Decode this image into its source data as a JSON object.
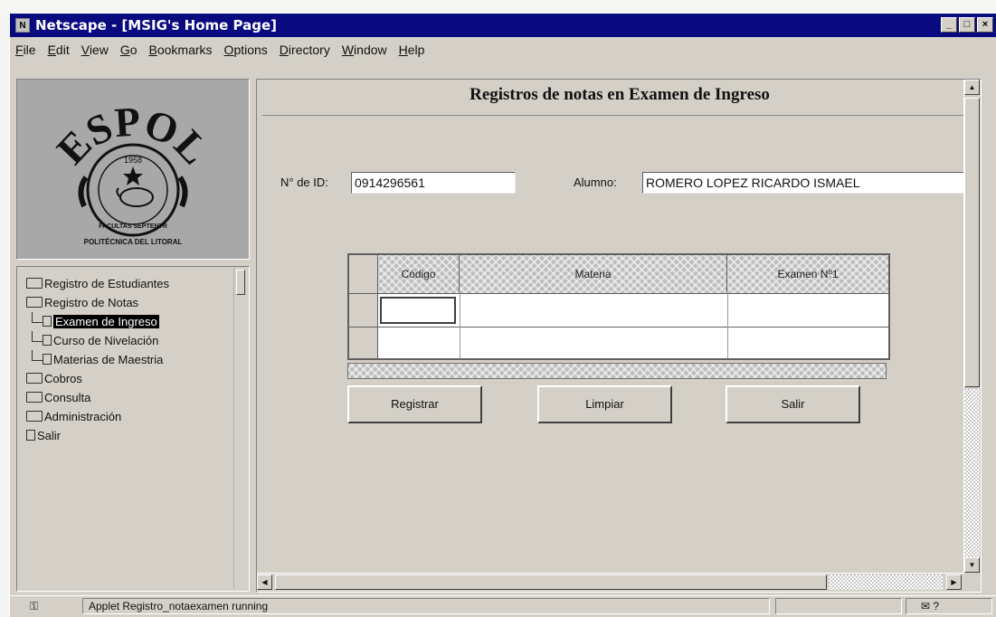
{
  "window": {
    "title": "Netscape - [MSIG's Home Page]",
    "app_icon": "N",
    "controls": [
      "_",
      "□",
      "×"
    ]
  },
  "menu": {
    "items": [
      "File",
      "Edit",
      "View",
      "Go",
      "Bookmarks",
      "Options",
      "Directory",
      "Window",
      "Help"
    ],
    "mnemonics": [
      "F",
      "E",
      "V",
      "G",
      "B",
      "O",
      "D",
      "W",
      "H"
    ]
  },
  "logo": {
    "name": "ESPOL",
    "year": "1958",
    "motto": "FACULTAS SEPTENTR",
    "institution": "POLITÉCNICA DEL LITORAL"
  },
  "tree": {
    "items": [
      {
        "label": "Registro de Estudiantes",
        "icon": "folder-icon",
        "level": 0,
        "selected": false
      },
      {
        "label": "Registro de Notas",
        "icon": "folder-open-icon",
        "level": 0,
        "selected": false
      },
      {
        "label": "Examen de Ingreso",
        "icon": "document-icon",
        "level": 1,
        "selected": true
      },
      {
        "label": "Curso de Nivelación",
        "icon": "document-icon",
        "level": 1,
        "selected": false
      },
      {
        "label": "Materias de Maestria",
        "icon": "document-icon",
        "level": 1,
        "selected": false
      },
      {
        "label": "Cobros",
        "icon": "folder-icon",
        "level": 0,
        "selected": false
      },
      {
        "label": "Consulta",
        "icon": "folder-icon",
        "level": 0,
        "selected": false
      },
      {
        "label": "Administración",
        "icon": "folder-icon",
        "level": 0,
        "selected": false
      },
      {
        "label": "Salir",
        "icon": "document-icon",
        "level": 0,
        "selected": false
      }
    ]
  },
  "form": {
    "title": "Registros de notas en Examen de Ingreso",
    "id_label": "N° de ID:",
    "id_value": "0914296561",
    "student_label": "Alumno:",
    "student_value": "ROMERO LOPEZ RICARDO ISMAEL"
  },
  "grid": {
    "columns": [
      "Código",
      "Materia",
      "Examen Nº1"
    ],
    "rows": [
      [
        "",
        "",
        ""
      ],
      [
        "",
        "",
        ""
      ]
    ]
  },
  "buttons": {
    "register": "Registrar",
    "clear": "Limpiar",
    "exit": "Salir"
  },
  "status": {
    "text": "Applet Registro_notaexamen running",
    "right": "?"
  }
}
